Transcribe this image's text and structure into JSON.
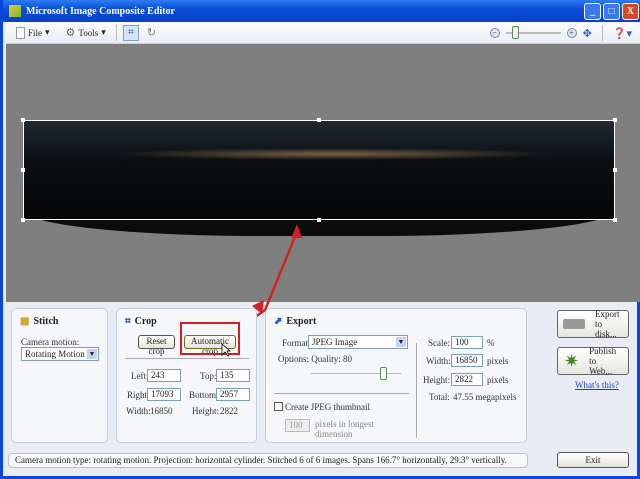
{
  "window": {
    "title": "Microsoft Image Composite Editor",
    "minimize": "_",
    "maximize": "□",
    "close": "X"
  },
  "toolbar": {
    "file": "File",
    "tools": "Tools",
    "crop_icon": "crop-icon",
    "help_icon": "help-icon",
    "zoom_level": 0.15
  },
  "stitch": {
    "title": "Stitch",
    "camera_motion_label": "Camera motion:",
    "camera_motion_value": "Rotating Motion"
  },
  "crop": {
    "title": "Crop",
    "reset": "Reset crop",
    "automatic": "Automatic crop",
    "left_label": "Left:",
    "left": "243",
    "top_label": "Top:",
    "top": "135",
    "right_label": "Right:",
    "right": "17093",
    "bottom_label": "Bottom:",
    "bottom": "2957",
    "width_label": "Width:",
    "width": "16850",
    "height_label": "Height:",
    "height": "2822"
  },
  "export": {
    "title": "Export",
    "format_label": "Format:",
    "format_value": "JPEG Image",
    "options": "Options: Quality: 80",
    "quality": 80,
    "thumb_label": "Create JPEG thumbnail",
    "thumb_value": "100",
    "thumb_unit": "pixels in longest dimension",
    "scale_label": "Scale:",
    "scale": "100",
    "scale_unit": "%",
    "width_label": "Width:",
    "width": "16850",
    "height_label": "Height:",
    "height": "2822",
    "pixels": "pixels",
    "total_label": "Total:",
    "total": "47.55 megapixels"
  },
  "actions": {
    "export_disk": "Export to disk...",
    "publish_web": "Publish to Web...",
    "whats_this": "What's this?",
    "exit": "Exit"
  },
  "status": "Camera motion type: rotating motion. Projection: horizontal cylinder. Stitched 6 of 6 images. Spans 166.7° horizontally, 29.3° vertically.",
  "colors": {
    "annotation": "#d42020",
    "titlebar": "#0a4fd6"
  }
}
